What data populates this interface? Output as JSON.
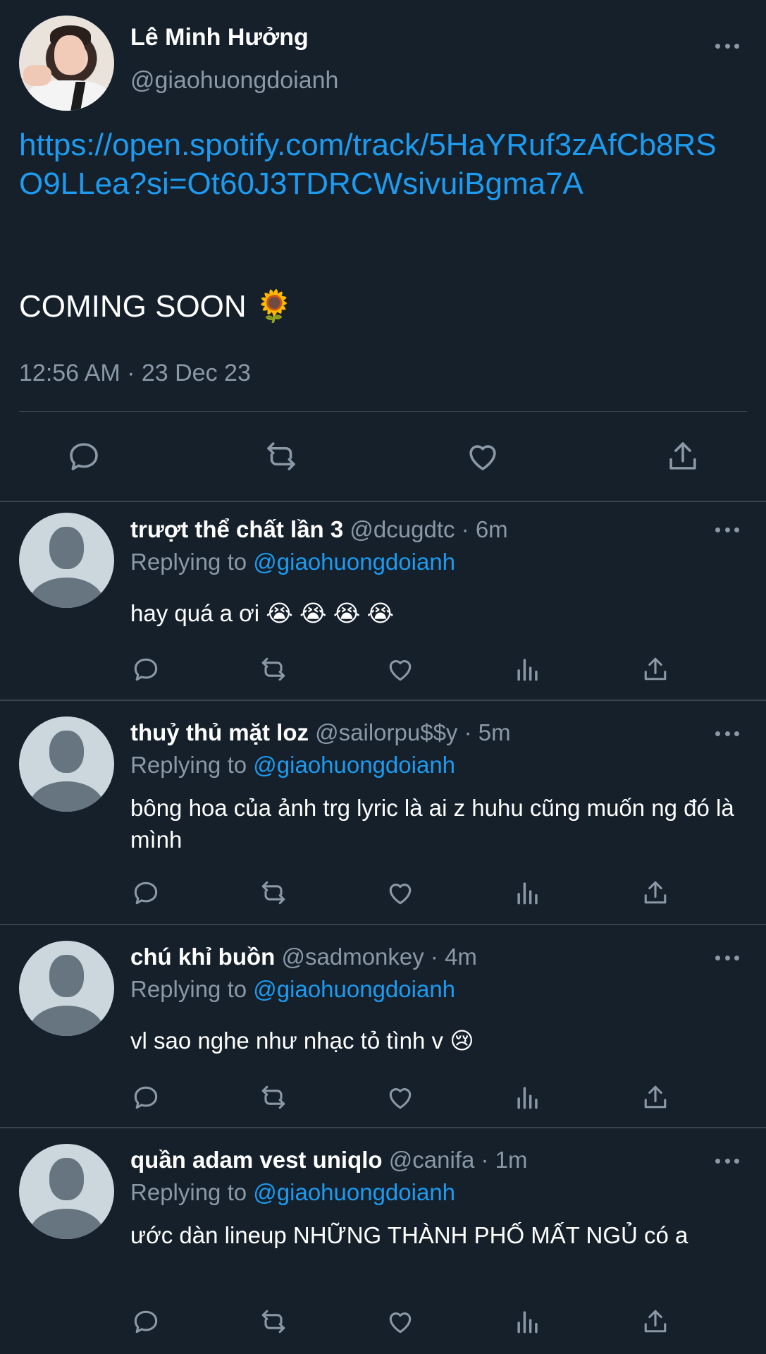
{
  "tweet": {
    "author_name": "Lê Minh Hưởng",
    "author_handle": "@giaohuongdoianh",
    "link": "https://open.spotify.com/track/5HaYRuf3zAfCb8RSO9LLea?si=Ot60J3TDRCWsivuiBgma7A",
    "text": "COMING SOON",
    "emoji": "🌻",
    "timestamp": "12:56 AM · 23 Dec 23"
  },
  "replies": [
    {
      "name": "trượt thể chất lần 3",
      "meta": "@dcugdtc · 6m",
      "replying_prefix": "Replying to",
      "replying_to": "@giaohuongdoianh",
      "text": "hay quá a ơi 😭 😭 😭 😭"
    },
    {
      "name": "thuỷ thủ mặt loz",
      "meta": "@sailorpu$$y · 5m",
      "replying_prefix": "Replying to",
      "replying_to": "@giaohuongdoianh",
      "text": "bông hoa của ảnh trg lyric là ai z huhu cũng muốn ng đó là mình"
    },
    {
      "name": "chú khỉ buồn",
      "meta": "@sadmonkey · 4m",
      "replying_prefix": "Replying to",
      "replying_to": "@giaohuongdoianh",
      "text": "vl sao nghe như nhạc tỏ tình v 😢"
    },
    {
      "name": "quần adam vest uniqlo",
      "meta": "@canifa · 1m",
      "replying_prefix": "Replying to",
      "replying_to": "@giaohuongdoianh",
      "text": "ước dàn lineup NHỮNG THÀNH PHỐ MẤT NGỦ có a"
    }
  ],
  "colors": {
    "background": "#15202b",
    "link": "#1d9bf0",
    "secondary_text": "#8b98a5",
    "divider": "#38444d"
  },
  "icons": [
    "more-icon",
    "reply-icon",
    "retweet-icon",
    "like-icon",
    "views-icon",
    "share-icon"
  ]
}
